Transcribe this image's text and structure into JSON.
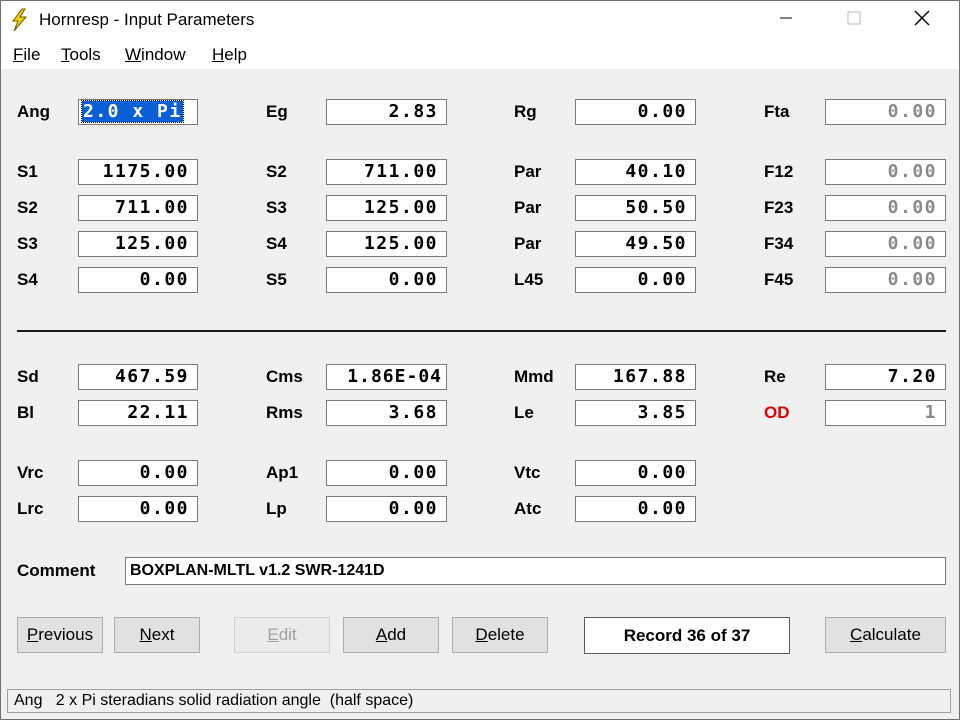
{
  "window": {
    "title": "Hornresp - Input Parameters"
  },
  "menu": [
    {
      "accel": "F",
      "rest": "ile"
    },
    {
      "accel": "T",
      "rest": "ools"
    },
    {
      "accel": "W",
      "rest": "indow"
    },
    {
      "accel": "H",
      "rest": "elp"
    }
  ],
  "top_block": {
    "ang": {
      "label": "Ang",
      "value": "2.0 x Pi"
    },
    "eg": {
      "label": "Eg",
      "value": "2.83"
    },
    "rg": {
      "label": "Rg",
      "value": "0.00"
    },
    "fta": {
      "label": "Fta",
      "value": "0.00"
    },
    "rows": [
      {
        "l1": "S1",
        "v1": "1175.00",
        "l2": "S2",
        "v2": "711.00",
        "l3": "Par",
        "v3": "40.10",
        "l4": "F12",
        "v4": "0.00"
      },
      {
        "l1": "S2",
        "v1": "711.00",
        "l2": "S3",
        "v2": "125.00",
        "l3": "Par",
        "v3": "50.50",
        "l4": "F23",
        "v4": "0.00"
      },
      {
        "l1": "S3",
        "v1": "125.00",
        "l2": "S4",
        "v2": "125.00",
        "l3": "Par",
        "v3": "49.50",
        "l4": "F34",
        "v4": "0.00"
      },
      {
        "l1": "S4",
        "v1": "0.00",
        "l2": "S5",
        "v2": "0.00",
        "l3": "L45",
        "v3": "0.00",
        "l4": "F45",
        "v4": "0.00"
      }
    ]
  },
  "driver": {
    "sd": {
      "label": "Sd",
      "value": "467.59"
    },
    "cms": {
      "label": "Cms",
      "value": "1.86E-04"
    },
    "mmd": {
      "label": "Mmd",
      "value": "167.88"
    },
    "re": {
      "label": "Re",
      "value": "7.20"
    },
    "bl": {
      "label": "Bl",
      "value": "22.11"
    },
    "rms": {
      "label": "Rms",
      "value": "3.68"
    },
    "le": {
      "label": "Le",
      "value": "3.85"
    },
    "od": {
      "label": "OD",
      "value": "1"
    }
  },
  "chamber": {
    "vrc": {
      "label": "Vrc",
      "value": "0.00"
    },
    "ap1": {
      "label": "Ap1",
      "value": "0.00"
    },
    "vtc": {
      "label": "Vtc",
      "value": "0.00"
    },
    "lrc": {
      "label": "Lrc",
      "value": "0.00"
    },
    "lp": {
      "label": "Lp",
      "value": "0.00"
    },
    "atc": {
      "label": "Atc",
      "value": "0.00"
    }
  },
  "comment": {
    "label": "Comment",
    "value": "BOXPLAN-MLTL v1.2 SWR-1241D"
  },
  "buttons": {
    "previous": {
      "accel": "P",
      "rest": "revious"
    },
    "next": {
      "accel": "N",
      "rest": "ext"
    },
    "edit": {
      "accel": "E",
      "rest": "dit"
    },
    "add": {
      "accel": "A",
      "rest": "dd"
    },
    "delete": {
      "accel": "D",
      "rest": "elete"
    },
    "record": "Record 36 of 37",
    "calculate": {
      "accel": "C",
      "rest": "alculate"
    }
  },
  "status": {
    "text": "Ang   2 x Pi steradians solid radiation angle  (half space)"
  },
  "colors": {
    "selection": "#0a5fd7",
    "od_label": "#e00000",
    "icon_yellow": "#f5d000"
  },
  "icons": {
    "app": "lightning-bolt-icon",
    "minimize": "minimize-icon",
    "maximize": "maximize-icon",
    "close": "close-icon"
  }
}
